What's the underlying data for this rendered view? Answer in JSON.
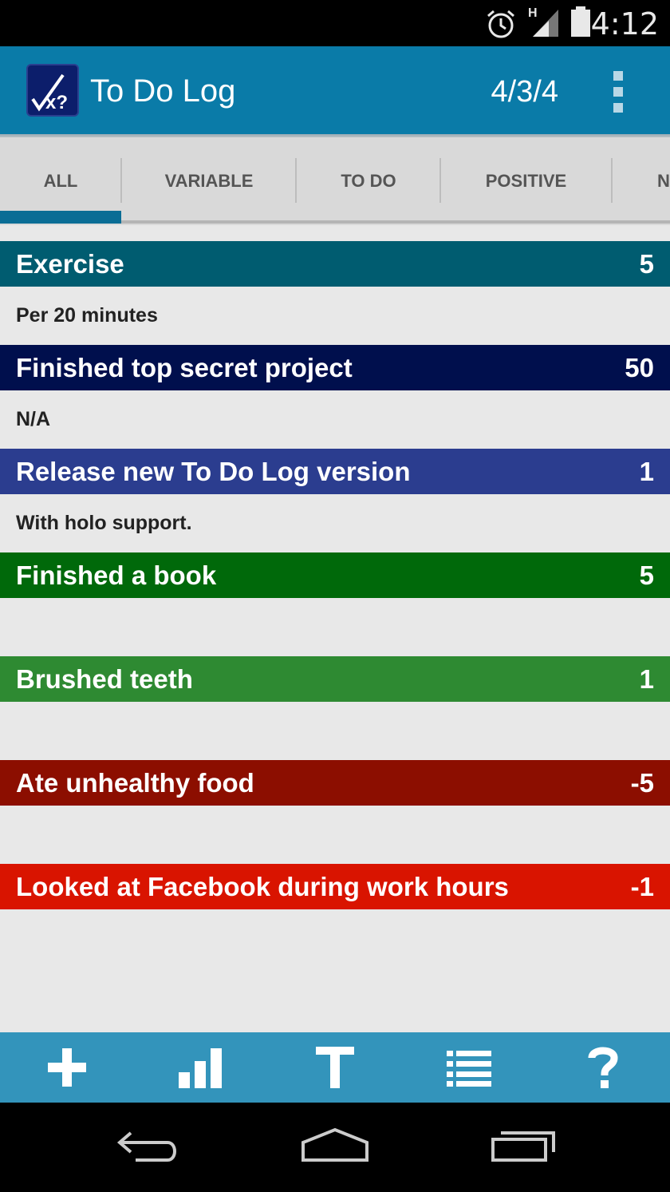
{
  "status_bar": {
    "time": "4:12",
    "network": "H",
    "icons": [
      "alarm-icon",
      "signal-icon",
      "battery-icon"
    ]
  },
  "action_bar": {
    "title": "To Do Log",
    "score": "4/3/4",
    "logo_text": "√x?",
    "overflow_icon": "overflow-menu-icon"
  },
  "tabs": [
    {
      "label": "ALL",
      "selected": true
    },
    {
      "label": "VARIABLE",
      "selected": false
    },
    {
      "label": "TO DO",
      "selected": false
    },
    {
      "label": "POSITIVE",
      "selected": false
    },
    {
      "label": "N",
      "selected": false
    }
  ],
  "items": [
    {
      "title": "Exercise",
      "points": "5",
      "description": "Per 20 minutes",
      "color": "#005c70"
    },
    {
      "title": "Finished top secret project",
      "points": "50",
      "description": "N/A",
      "color": "#000f4d"
    },
    {
      "title": "Release new To Do Log version",
      "points": "1",
      "description": "With holo support.",
      "color": "#2b3d8f"
    },
    {
      "title": "Finished a book",
      "points": "5",
      "description": "",
      "color": "#00690a"
    },
    {
      "title": "Brushed teeth",
      "points": "1",
      "description": "",
      "color": "#2e8a32"
    },
    {
      "title": "Ate unhealthy food",
      "points": "-5",
      "description": "",
      "color": "#8c0e00"
    },
    {
      "title": "Looked at Facebook during work hours",
      "points": "-1",
      "description": "",
      "color": "#d91400"
    }
  ],
  "bottom_toolbar": [
    {
      "name": "add-icon"
    },
    {
      "name": "stats-icon"
    },
    {
      "name": "text-icon"
    },
    {
      "name": "list-icon"
    },
    {
      "name": "help-icon"
    }
  ],
  "nav_bar": [
    "back-icon",
    "home-icon",
    "recents-icon"
  ],
  "colors": {
    "action_bar": "#0a7ba8",
    "bottom_bar": "#3394bb",
    "tab_indicator": "#0a6d95",
    "background": "#e8e8e8"
  }
}
